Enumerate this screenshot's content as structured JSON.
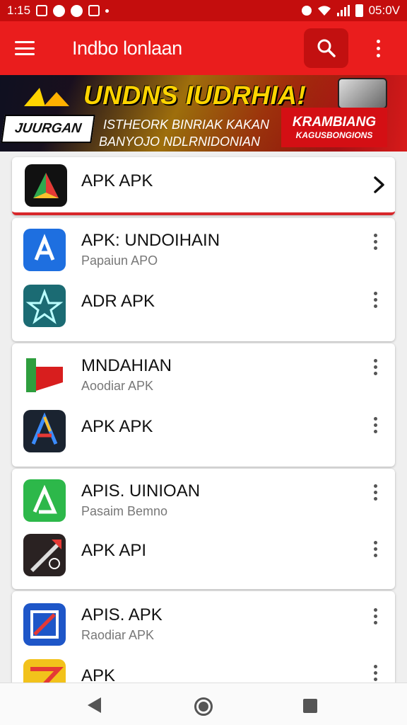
{
  "status_bar": {
    "time": "1:15",
    "right_time": "05:0V",
    "icons": [
      "notification-icon",
      "app-icon",
      "play-icon",
      "image-icon",
      "dot-icon",
      "alarm-icon",
      "wifi-icon",
      "signal-icon",
      "battery-icon"
    ]
  },
  "app_bar": {
    "title": "Indbo lonlaan",
    "menu_icon": "hamburger-icon",
    "search_icon": "search-icon",
    "overflow_icon": "more-vert-icon"
  },
  "banner": {
    "headline": "UNDNS IUDRHIA!",
    "brand": "JUURGAN",
    "sub_line_1": "ISTHEORK BINRIAK KAKAN",
    "sub_line_2": "BANYOJO NDLRNIDONIAN",
    "cta_line_1": "KRAMBIANG",
    "cta_line_2": "KAGUSBONGIONS"
  },
  "featured": {
    "title": "APK APK",
    "chevron_icon": "chevron-right-icon"
  },
  "cards": [
    {
      "items": [
        {
          "title": "APK: UNDOIHAIN",
          "subtitle": "Papaiun APO",
          "icon": "blue-a-icon"
        },
        {
          "title": "ADR APK",
          "subtitle": "",
          "icon": "teal-star-icon"
        }
      ]
    },
    {
      "items": [
        {
          "title": "MNDAHIAN",
          "subtitle": "Aoodiar APK",
          "icon": "red-green-flag-icon"
        },
        {
          "title": "APK APK",
          "subtitle": "",
          "icon": "multicolor-a-icon"
        }
      ]
    },
    {
      "items": [
        {
          "title": "APIS. UINIOAN",
          "subtitle": "Pasaim Bemno",
          "icon": "green-a-icon"
        },
        {
          "title": "APK API",
          "subtitle": "",
          "icon": "red-arrow-icon"
        }
      ]
    },
    {
      "items": [
        {
          "title": "APIS. APK",
          "subtitle": "Raodiar APK",
          "icon": "blue-frame-icon"
        },
        {
          "title": "APK",
          "subtitle": "",
          "icon": "yellow-red-icon"
        }
      ]
    }
  ],
  "colors": {
    "app_bar": "#ea1d1d",
    "status_bar": "#c40d0d",
    "search_button": "#c21010",
    "divider_accent": "#d8262a"
  },
  "nav_bar": {
    "icons": [
      "back-icon",
      "home-icon",
      "recents-icon"
    ]
  }
}
